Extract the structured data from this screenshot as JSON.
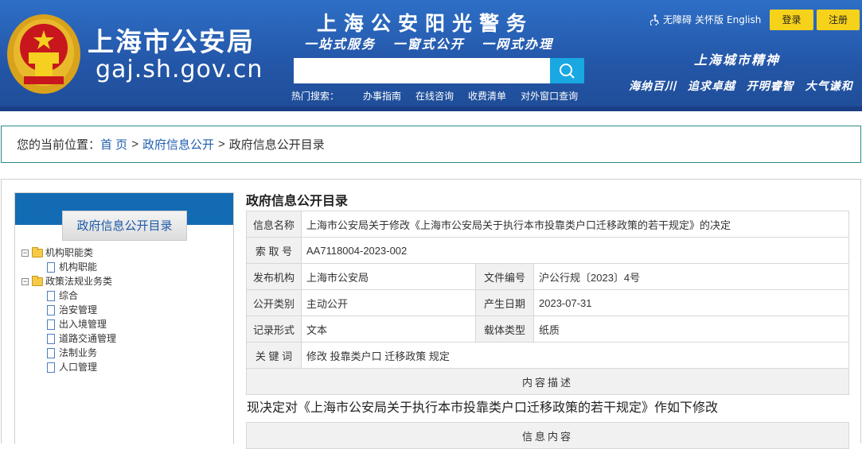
{
  "header": {
    "site_name": "上海市公安局",
    "site_url": "gaj.sh.gov.cn",
    "slogan": "上海公安阳光警务",
    "slogan_sub": "一站式服务 一窗式公开 一网式办理",
    "search": {
      "value": "",
      "placeholder": ""
    },
    "hot_label": "热门搜索：",
    "hot_links": [
      "办事指南",
      "在线咨询",
      "收费清单",
      "对外窗口查询"
    ],
    "accessibility": "无障碍",
    "care_mode": "关怀版",
    "english": "English",
    "login": "登录",
    "register": "注册",
    "city_title": "上海城市精神",
    "city_spirit": "海纳百川 追求卓越 开明睿智 大气谦和",
    "colors": {
      "header_bg": "#2457a9",
      "button": "#f7d21a",
      "search_btn": "#19a8e2"
    }
  },
  "breadcrumb": {
    "prefix": "您的当前位置：",
    "items": [
      "首 页",
      "政府信息公开",
      "政府信息公开目录"
    ],
    "separator": ">"
  },
  "sidebar": {
    "title": "政府信息公开目录",
    "tree": [
      {
        "label": "机构职能类",
        "expanded": true,
        "children": [
          "机构职能"
        ]
      },
      {
        "label": "政策法规业务类",
        "expanded": true,
        "children": [
          "综合",
          "治安管理",
          "出入境管理",
          "道路交通管理",
          "法制业务",
          "人口管理"
        ]
      }
    ]
  },
  "content": {
    "title": "政府信息公开目录",
    "info_name_label": "信息名称",
    "info_name": "上海市公安局关于修改《上海市公安局关于执行本市投靠类户口迁移政策的若干规定》的决定",
    "index_label": "索 取 号",
    "index_no": "AA7118004-2023-002",
    "publisher_label": "发布机构",
    "publisher": "上海市公安局",
    "doc_no_label": "文件编号",
    "doc_no": "沪公行规〔2023〕4号",
    "category_label": "公开类别",
    "category": "主动公开",
    "date_label": "产生日期",
    "date": "2023-07-31",
    "format_label": "记录形式",
    "format": "文本",
    "carrier_label": "载体类型",
    "carrier": "纸质",
    "keywords_label": "关 键 词",
    "keywords": "修改 投靠类户口 迁移政策 规定",
    "desc_header": "内容描述",
    "desc_text": "现决定对《上海市公安局关于执行本市投靠类户口迁移政策的若干规定》作如下修改",
    "info_content_header": "信息内容"
  }
}
